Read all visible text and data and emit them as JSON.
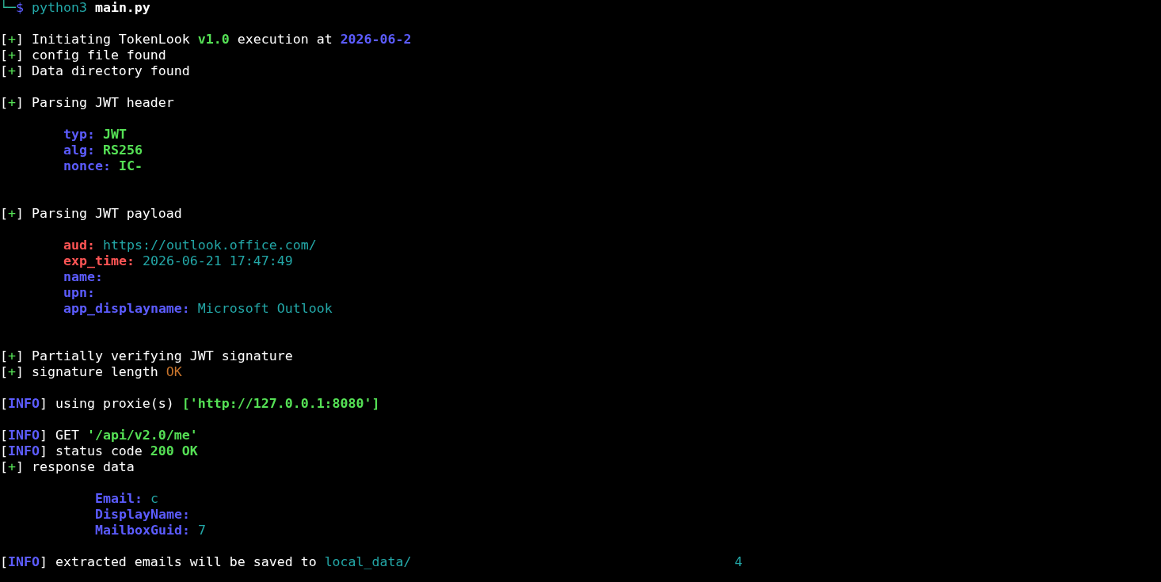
{
  "terminal": {
    "lines": [
      {
        "kind": "prompt",
        "segments": [
          {
            "text": "└─",
            "color": "#2fb89a"
          },
          {
            "text": "$ ",
            "color": "#5c5cff",
            "bold": false
          },
          {
            "text": "python3 ",
            "color": "#23a7a7",
            "bold": false
          },
          {
            "text": "main.py",
            "color": "#ffffff",
            "bold": true
          }
        ]
      },
      {
        "kind": "blank"
      },
      {
        "kind": "output",
        "segments": [
          {
            "text": "[",
            "color": "#ffffff",
            "bold": false
          },
          {
            "text": "+",
            "color": "#55e055",
            "bold": false
          },
          {
            "text": "] Initiating TokenLook ",
            "color": "#ffffff",
            "bold": false
          },
          {
            "text": "v1.0",
            "color": "#55e055",
            "bold": true
          },
          {
            "text": " execution at ",
            "color": "#ffffff",
            "bold": false
          },
          {
            "text": "2026-06-2",
            "color": "#5c5cff",
            "bold": true
          }
        ]
      },
      {
        "kind": "output",
        "segments": [
          {
            "text": "[",
            "color": "#ffffff",
            "bold": false
          },
          {
            "text": "+",
            "color": "#55e055",
            "bold": false
          },
          {
            "text": "] config file found",
            "color": "#ffffff",
            "bold": false
          }
        ]
      },
      {
        "kind": "output",
        "segments": [
          {
            "text": "[",
            "color": "#ffffff",
            "bold": false
          },
          {
            "text": "+",
            "color": "#55e055",
            "bold": false
          },
          {
            "text": "] Data directory found",
            "color": "#ffffff",
            "bold": false
          }
        ]
      },
      {
        "kind": "blank"
      },
      {
        "kind": "output",
        "segments": [
          {
            "text": "[",
            "color": "#ffffff",
            "bold": false
          },
          {
            "text": "+",
            "color": "#55e055",
            "bold": false
          },
          {
            "text": "] Parsing JWT header",
            "color": "#ffffff",
            "bold": false
          }
        ]
      },
      {
        "kind": "blank"
      },
      {
        "kind": "field",
        "segments": [
          {
            "text": "typ: ",
            "color": "#5c5cff",
            "bold": true
          },
          {
            "text": "JWT",
            "color": "#55e055",
            "bold": true
          }
        ]
      },
      {
        "kind": "field",
        "segments": [
          {
            "text": "alg: ",
            "color": "#5c5cff",
            "bold": true
          },
          {
            "text": "RS256",
            "color": "#55e055",
            "bold": true
          }
        ]
      },
      {
        "kind": "field",
        "segments": [
          {
            "text": "nonce: ",
            "color": "#5c5cff",
            "bold": true
          },
          {
            "text": "IC-",
            "color": "#55e055",
            "bold": true
          }
        ]
      },
      {
        "kind": "blank"
      },
      {
        "kind": "blank"
      },
      {
        "kind": "output",
        "segments": [
          {
            "text": "[",
            "color": "#ffffff",
            "bold": false
          },
          {
            "text": "+",
            "color": "#55e055",
            "bold": false
          },
          {
            "text": "] Parsing JWT payload",
            "color": "#ffffff",
            "bold": false
          }
        ]
      },
      {
        "kind": "blank"
      },
      {
        "kind": "field",
        "segments": [
          {
            "text": "aud: ",
            "color": "#ff5555",
            "bold": true
          },
          {
            "text": "https://outlook.office.com/",
            "color": "#23a7a7",
            "bold": false
          }
        ]
      },
      {
        "kind": "field",
        "segments": [
          {
            "text": "exp_time: ",
            "color": "#ff5555",
            "bold": true
          },
          {
            "text": "2026-06-21 17:47:49",
            "color": "#23a7a7",
            "bold": false
          }
        ]
      },
      {
        "kind": "field",
        "segments": [
          {
            "text": "name:",
            "color": "#5c5cff",
            "bold": true
          }
        ]
      },
      {
        "kind": "field",
        "segments": [
          {
            "text": "upn:",
            "color": "#5c5cff",
            "bold": true
          }
        ]
      },
      {
        "kind": "field",
        "segments": [
          {
            "text": "app_displayname: ",
            "color": "#5c5cff",
            "bold": true
          },
          {
            "text": "Microsoft Outlook",
            "color": "#23a7a7",
            "bold": false
          }
        ]
      },
      {
        "kind": "blank"
      },
      {
        "kind": "blank"
      },
      {
        "kind": "output",
        "segments": [
          {
            "text": "[",
            "color": "#ffffff",
            "bold": false
          },
          {
            "text": "+",
            "color": "#55e055",
            "bold": false
          },
          {
            "text": "] Partially verifying JWT signature",
            "color": "#ffffff",
            "bold": false
          }
        ]
      },
      {
        "kind": "output",
        "segments": [
          {
            "text": "[",
            "color": "#ffffff",
            "bold": false
          },
          {
            "text": "+",
            "color": "#55e055",
            "bold": false
          },
          {
            "text": "] signature length ",
            "color": "#ffffff",
            "bold": false
          },
          {
            "text": "OK",
            "color": "#c8742c",
            "bold": false
          }
        ]
      },
      {
        "kind": "blank"
      },
      {
        "kind": "output",
        "segments": [
          {
            "text": "[",
            "color": "#ffffff",
            "bold": false
          },
          {
            "text": "INFO",
            "color": "#5c5cff",
            "bold": true
          },
          {
            "text": "] using proxie(s) ",
            "color": "#ffffff",
            "bold": false
          },
          {
            "text": "['http://127.0.0.1:8080']",
            "color": "#55e055",
            "bold": true
          }
        ]
      },
      {
        "kind": "blank"
      },
      {
        "kind": "output",
        "segments": [
          {
            "text": "[",
            "color": "#ffffff",
            "bold": false
          },
          {
            "text": "INFO",
            "color": "#5c5cff",
            "bold": true
          },
          {
            "text": "] GET ",
            "color": "#ffffff",
            "bold": false
          },
          {
            "text": "'/api/v2.0/me'",
            "color": "#55e055",
            "bold": true
          }
        ]
      },
      {
        "kind": "output",
        "segments": [
          {
            "text": "[",
            "color": "#ffffff",
            "bold": false
          },
          {
            "text": "INFO",
            "color": "#5c5cff",
            "bold": true
          },
          {
            "text": "] status code ",
            "color": "#ffffff",
            "bold": false
          },
          {
            "text": "200 OK",
            "color": "#55e055",
            "bold": true
          }
        ]
      },
      {
        "kind": "output",
        "segments": [
          {
            "text": "[",
            "color": "#ffffff",
            "bold": false
          },
          {
            "text": "+",
            "color": "#55e055",
            "bold": false
          },
          {
            "text": "] response data",
            "color": "#ffffff",
            "bold": false
          }
        ]
      },
      {
        "kind": "blank"
      },
      {
        "kind": "nested_field",
        "segments": [
          {
            "text": "Email: ",
            "color": "#5c5cff",
            "bold": true
          },
          {
            "text": "c",
            "color": "#23a7a7",
            "bold": false
          }
        ]
      },
      {
        "kind": "nested_field",
        "segments": [
          {
            "text": "DisplayName:",
            "color": "#5c5cff",
            "bold": true
          }
        ]
      },
      {
        "kind": "nested_field",
        "segments": [
          {
            "text": "MailboxGuid: ",
            "color": "#5c5cff",
            "bold": true
          },
          {
            "text": "7",
            "color": "#23a7a7",
            "bold": false
          }
        ]
      },
      {
        "kind": "blank"
      },
      {
        "kind": "output",
        "segments": [
          {
            "text": "[",
            "color": "#ffffff",
            "bold": false
          },
          {
            "text": "INFO",
            "color": "#5c5cff",
            "bold": true
          },
          {
            "text": "] extracted emails will be saved to ",
            "color": "#ffffff",
            "bold": false
          },
          {
            "text": "local_data/",
            "color": "#23a7a7",
            "bold": false
          }
        ],
        "tail": {
          "text": "4",
          "color": "#23a7a7"
        }
      }
    ]
  }
}
